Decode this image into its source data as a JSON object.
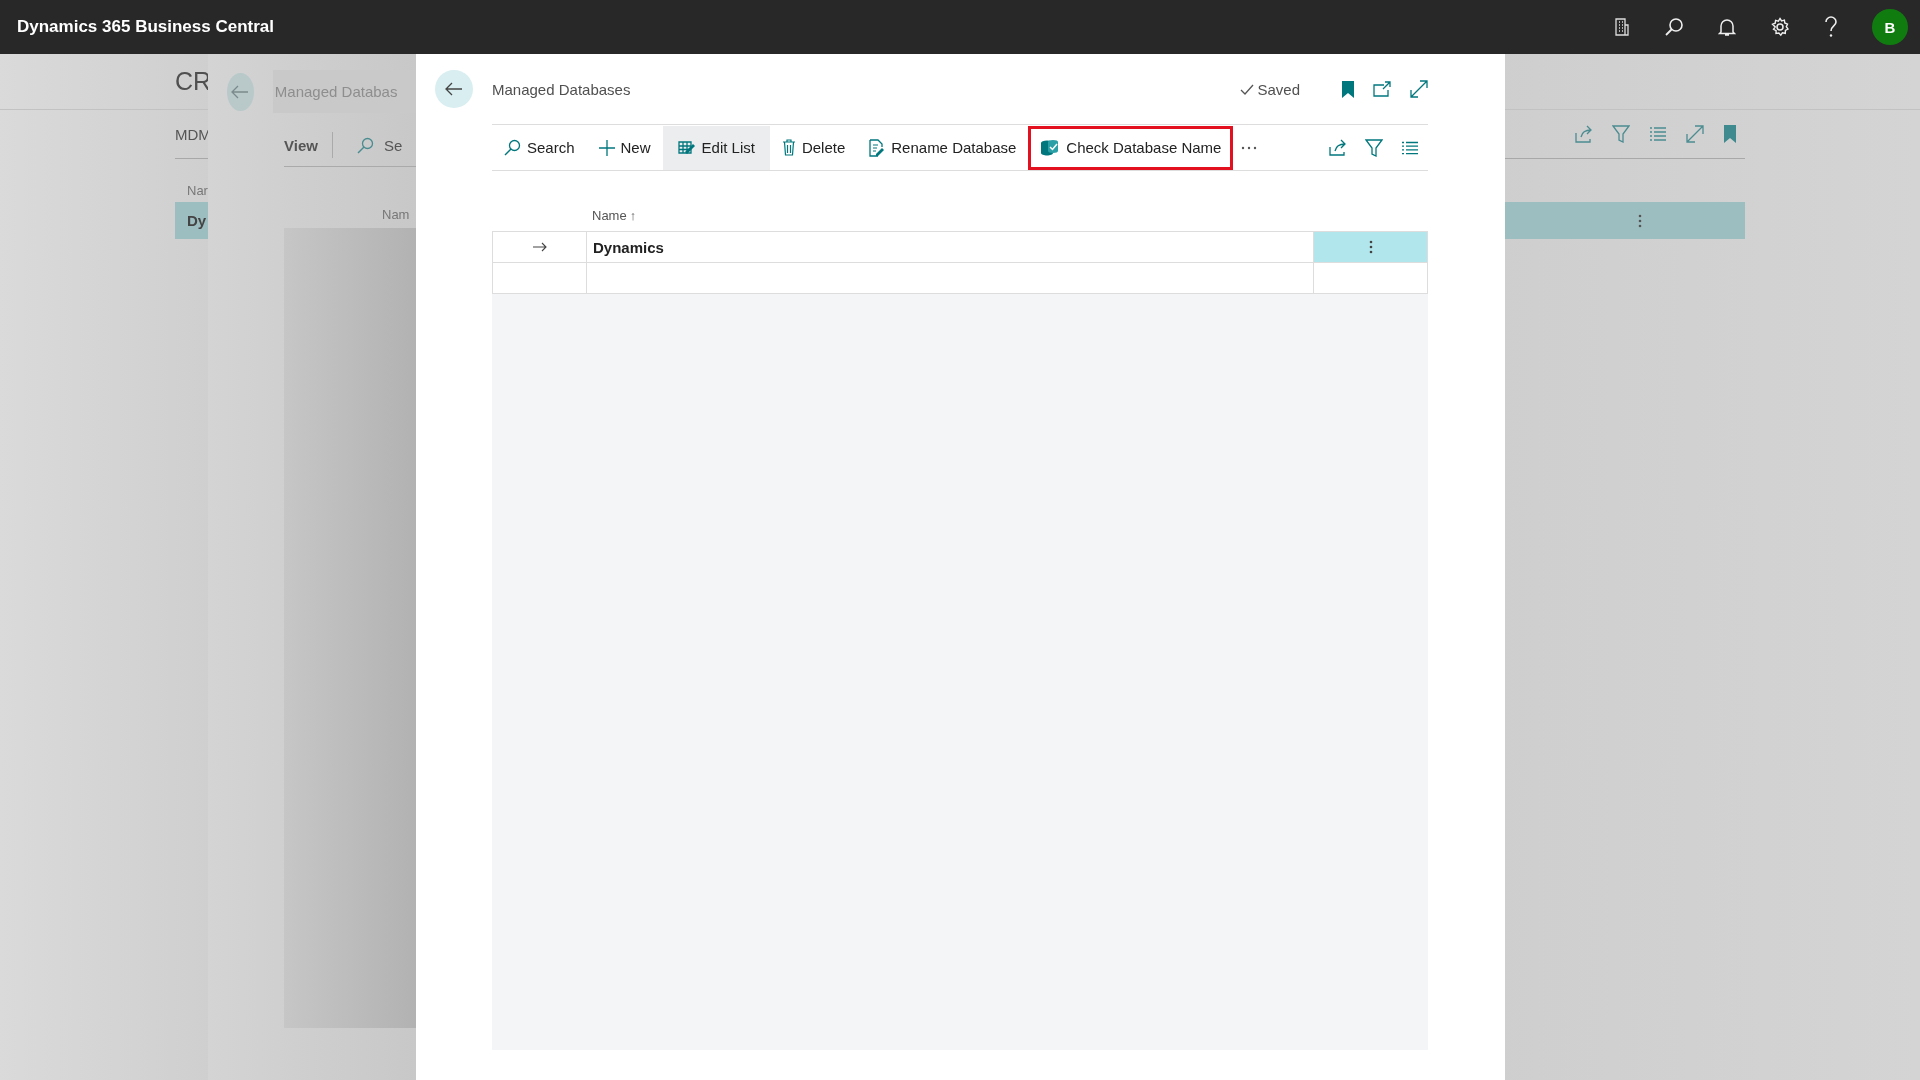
{
  "top_bar": {
    "app_title": "Dynamics 365 Business Central",
    "avatar": "B"
  },
  "background_page": {
    "title": "CR",
    "tab": "MDM",
    "column": "Nar",
    "row": {
      "name": "Dy",
      "selected": true
    }
  },
  "middle_panel": {
    "search_field": {
      "placeholder": "Managed Databas"
    },
    "view_tab": "View",
    "search_action": "Se",
    "column": "Nam"
  },
  "dialog": {
    "title": "Managed Databases",
    "status": "Saved",
    "actions": [
      {
        "label": "Search",
        "kind": "search",
        "selected": false,
        "highlighted": false
      },
      {
        "label": "New",
        "kind": "new",
        "selected": false,
        "highlighted": false
      },
      {
        "label": "Edit List",
        "kind": "edit",
        "selected": true,
        "highlighted": false
      },
      {
        "label": "Delete",
        "kind": "delete",
        "selected": false,
        "highlighted": false
      },
      {
        "label": "Rename Database",
        "kind": "rename",
        "selected": false,
        "highlighted": false
      },
      {
        "label": "Check Database Name",
        "kind": "check",
        "selected": false,
        "highlighted": true
      }
    ],
    "table": {
      "column": "Name",
      "sort_mark": "↑",
      "rows": [
        {
          "name": "Dynamics",
          "selected": true
        },
        {
          "selected": false
        }
      ]
    }
  }
}
